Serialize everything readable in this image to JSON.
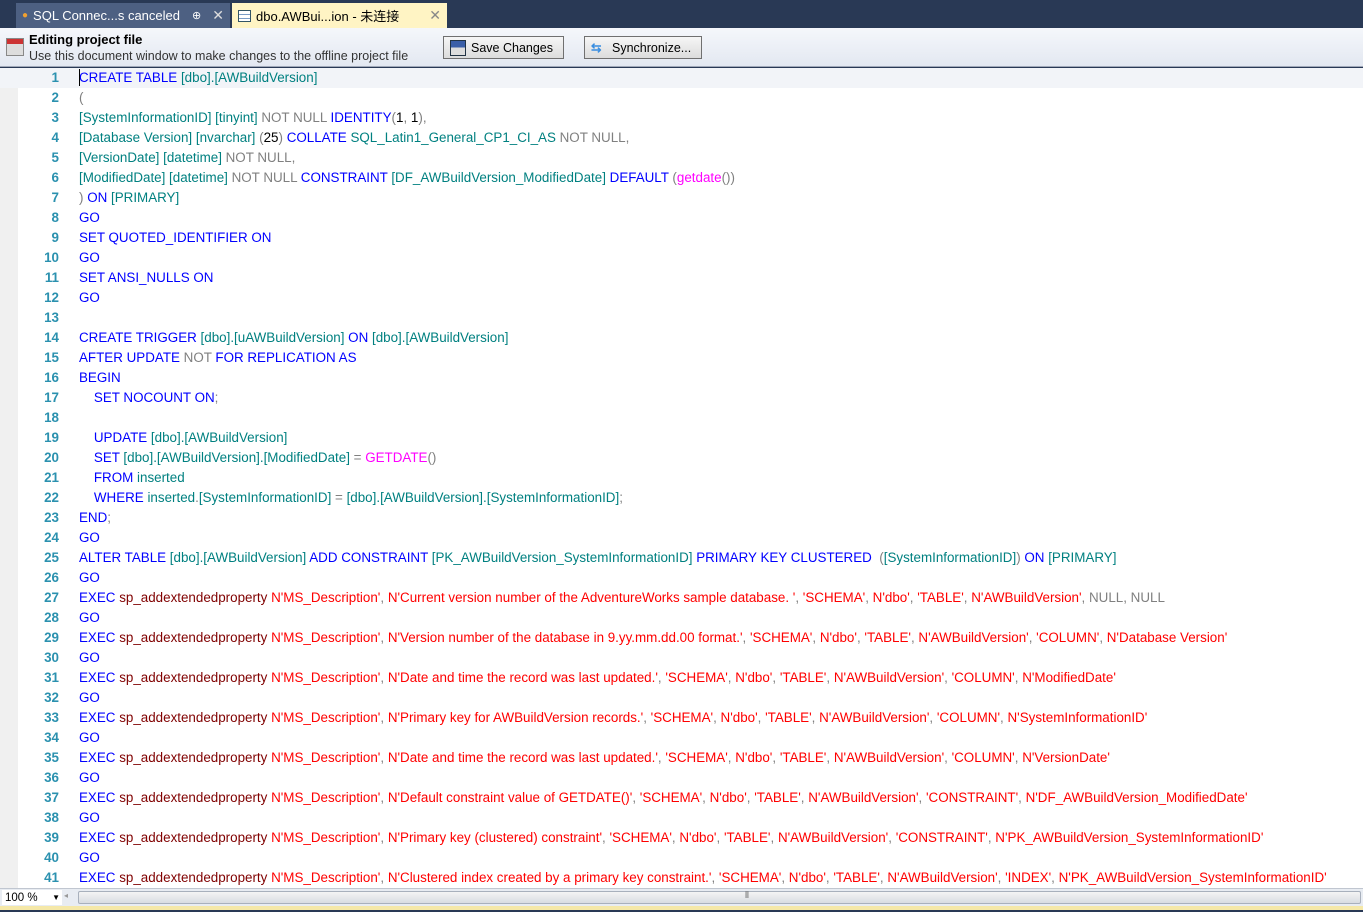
{
  "tabs": [
    {
      "label": "SQL Connec...s canceled",
      "icon": "connection-icon",
      "pin": "⊕",
      "close": "✕"
    },
    {
      "label": "dbo.AWBui...ion - 未连接",
      "icon": "table-icon",
      "close": "✕"
    }
  ],
  "infobar": {
    "title": "Editing project file",
    "subtitle": "Use this document window to make changes to the offline project file",
    "save_label": "Save Changes",
    "sync_label": "Synchronize..."
  },
  "colors": {
    "keyword": "#0000ff",
    "identifier": "#008080",
    "operator": "#808080",
    "string": "#ff0000",
    "function": "#ff00ff",
    "sysproc": "#800000",
    "line_number": "#2b91af"
  },
  "editor": {
    "zoom": "100 %",
    "lines": [
      [
        [
          "k",
          "CREATE TABLE "
        ],
        [
          "i",
          "[dbo].[AWBuildVersion]"
        ]
      ],
      [
        [
          "g",
          "("
        ]
      ],
      [
        [
          "i",
          "[SystemInformationID] [tinyint] "
        ],
        [
          "g",
          "NOT NULL "
        ],
        [
          "k",
          "IDENTITY"
        ],
        [
          "g",
          "("
        ],
        [
          "n",
          "1"
        ],
        [
          "g",
          ", "
        ],
        [
          "n",
          "1"
        ],
        [
          "g",
          "),"
        ]
      ],
      [
        [
          "i",
          "[Database Version] [nvarchar] "
        ],
        [
          "g",
          "("
        ],
        [
          "n",
          "25"
        ],
        [
          "g",
          ") "
        ],
        [
          "k",
          "COLLATE "
        ],
        [
          "i",
          "SQL_Latin1_General_CP1_CI_AS "
        ],
        [
          "g",
          "NOT NULL,"
        ]
      ],
      [
        [
          "i",
          "[VersionDate] [datetime] "
        ],
        [
          "g",
          "NOT NULL,"
        ]
      ],
      [
        [
          "i",
          "[ModifiedDate] [datetime] "
        ],
        [
          "g",
          "NOT NULL "
        ],
        [
          "k",
          "CONSTRAINT "
        ],
        [
          "i",
          "[DF_AWBuildVersion_ModifiedDate] "
        ],
        [
          "k",
          "DEFAULT "
        ],
        [
          "g",
          "("
        ],
        [
          "f",
          "getdate"
        ],
        [
          "g",
          "())"
        ]
      ],
      [
        [
          "g",
          ") "
        ],
        [
          "k",
          "ON "
        ],
        [
          "i",
          "[PRIMARY]"
        ]
      ],
      [
        [
          "k",
          "GO"
        ]
      ],
      [
        [
          "k",
          "SET QUOTED_IDENTIFIER ON"
        ]
      ],
      [
        [
          "k",
          "GO"
        ]
      ],
      [
        [
          "k",
          "SET ANSI_NULLS ON"
        ]
      ],
      [
        [
          "k",
          "GO"
        ]
      ],
      [],
      [
        [
          "k",
          "CREATE TRIGGER "
        ],
        [
          "i",
          "[dbo].[uAWBuildVersion] "
        ],
        [
          "k",
          "ON "
        ],
        [
          "i",
          "[dbo].[AWBuildVersion]"
        ]
      ],
      [
        [
          "k",
          "AFTER UPDATE "
        ],
        [
          "g",
          "NOT "
        ],
        [
          "k",
          "FOR REPLICATION AS"
        ]
      ],
      [
        [
          "k",
          "BEGIN"
        ]
      ],
      [
        [
          "k",
          "    SET NOCOUNT ON"
        ],
        [
          "g",
          ";"
        ]
      ],
      [],
      [
        [
          "k",
          "    UPDATE "
        ],
        [
          "i",
          "[dbo].[AWBuildVersion]"
        ]
      ],
      [
        [
          "k",
          "    SET "
        ],
        [
          "i",
          "[dbo].[AWBuildVersion].[ModifiedDate] "
        ],
        [
          "g",
          "= "
        ],
        [
          "f",
          "GETDATE"
        ],
        [
          "g",
          "()"
        ]
      ],
      [
        [
          "k",
          "    FROM "
        ],
        [
          "i",
          "inserted"
        ]
      ],
      [
        [
          "k",
          "    WHERE "
        ],
        [
          "i",
          "inserted"
        ],
        [
          "g",
          "."
        ],
        [
          "i",
          "[SystemInformationID] "
        ],
        [
          "g",
          "= "
        ],
        [
          "i",
          "[dbo].[AWBuildVersion].[SystemInformationID]"
        ],
        [
          "g",
          ";"
        ]
      ],
      [
        [
          "k",
          "END"
        ],
        [
          "g",
          ";"
        ]
      ],
      [
        [
          "k",
          "GO"
        ]
      ],
      [
        [
          "k",
          "ALTER TABLE "
        ],
        [
          "i",
          "[dbo].[AWBuildVersion] "
        ],
        [
          "k",
          "ADD CONSTRAINT "
        ],
        [
          "i",
          "[PK_AWBuildVersion_SystemInformationID] "
        ],
        [
          "k",
          "PRIMARY KEY CLUSTERED "
        ],
        [
          "g",
          " ("
        ],
        [
          "i",
          "[SystemInformationID]"
        ],
        [
          "g",
          ") "
        ],
        [
          "k",
          "ON "
        ],
        [
          "i",
          "[PRIMARY]"
        ]
      ],
      [
        [
          "k",
          "GO"
        ]
      ],
      [
        [
          "k",
          "EXEC "
        ],
        [
          "p",
          "sp_addextendedproperty "
        ],
        [
          "s",
          "N'MS_Description'"
        ],
        [
          "g",
          ", "
        ],
        [
          "s",
          "N'Current version number of the AdventureWorks sample database. '"
        ],
        [
          "g",
          ", "
        ],
        [
          "s",
          "'SCHEMA'"
        ],
        [
          "g",
          ", "
        ],
        [
          "s",
          "N'dbo'"
        ],
        [
          "g",
          ", "
        ],
        [
          "s",
          "'TABLE'"
        ],
        [
          "g",
          ", "
        ],
        [
          "s",
          "N'AWBuildVersion'"
        ],
        [
          "g",
          ", NULL, NULL"
        ]
      ],
      [
        [
          "k",
          "GO"
        ]
      ],
      [
        [
          "k",
          "EXEC "
        ],
        [
          "p",
          "sp_addextendedproperty "
        ],
        [
          "s",
          "N'MS_Description'"
        ],
        [
          "g",
          ", "
        ],
        [
          "s",
          "N'Version number of the database in 9.yy.mm.dd.00 format.'"
        ],
        [
          "g",
          ", "
        ],
        [
          "s",
          "'SCHEMA'"
        ],
        [
          "g",
          ", "
        ],
        [
          "s",
          "N'dbo'"
        ],
        [
          "g",
          ", "
        ],
        [
          "s",
          "'TABLE'"
        ],
        [
          "g",
          ", "
        ],
        [
          "s",
          "N'AWBuildVersion'"
        ],
        [
          "g",
          ", "
        ],
        [
          "s",
          "'COLUMN'"
        ],
        [
          "g",
          ", "
        ],
        [
          "s",
          "N'Database Version'"
        ]
      ],
      [
        [
          "k",
          "GO"
        ]
      ],
      [
        [
          "k",
          "EXEC "
        ],
        [
          "p",
          "sp_addextendedproperty "
        ],
        [
          "s",
          "N'MS_Description'"
        ],
        [
          "g",
          ", "
        ],
        [
          "s",
          "N'Date and time the record was last updated.'"
        ],
        [
          "g",
          ", "
        ],
        [
          "s",
          "'SCHEMA'"
        ],
        [
          "g",
          ", "
        ],
        [
          "s",
          "N'dbo'"
        ],
        [
          "g",
          ", "
        ],
        [
          "s",
          "'TABLE'"
        ],
        [
          "g",
          ", "
        ],
        [
          "s",
          "N'AWBuildVersion'"
        ],
        [
          "g",
          ", "
        ],
        [
          "s",
          "'COLUMN'"
        ],
        [
          "g",
          ", "
        ],
        [
          "s",
          "N'ModifiedDate'"
        ]
      ],
      [
        [
          "k",
          "GO"
        ]
      ],
      [
        [
          "k",
          "EXEC "
        ],
        [
          "p",
          "sp_addextendedproperty "
        ],
        [
          "s",
          "N'MS_Description'"
        ],
        [
          "g",
          ", "
        ],
        [
          "s",
          "N'Primary key for AWBuildVersion records.'"
        ],
        [
          "g",
          ", "
        ],
        [
          "s",
          "'SCHEMA'"
        ],
        [
          "g",
          ", "
        ],
        [
          "s",
          "N'dbo'"
        ],
        [
          "g",
          ", "
        ],
        [
          "s",
          "'TABLE'"
        ],
        [
          "g",
          ", "
        ],
        [
          "s",
          "N'AWBuildVersion'"
        ],
        [
          "g",
          ", "
        ],
        [
          "s",
          "'COLUMN'"
        ],
        [
          "g",
          ", "
        ],
        [
          "s",
          "N'SystemInformationID'"
        ]
      ],
      [
        [
          "k",
          "GO"
        ]
      ],
      [
        [
          "k",
          "EXEC "
        ],
        [
          "p",
          "sp_addextendedproperty "
        ],
        [
          "s",
          "N'MS_Description'"
        ],
        [
          "g",
          ", "
        ],
        [
          "s",
          "N'Date and time the record was last updated.'"
        ],
        [
          "g",
          ", "
        ],
        [
          "s",
          "'SCHEMA'"
        ],
        [
          "g",
          ", "
        ],
        [
          "s",
          "N'dbo'"
        ],
        [
          "g",
          ", "
        ],
        [
          "s",
          "'TABLE'"
        ],
        [
          "g",
          ", "
        ],
        [
          "s",
          "N'AWBuildVersion'"
        ],
        [
          "g",
          ", "
        ],
        [
          "s",
          "'COLUMN'"
        ],
        [
          "g",
          ", "
        ],
        [
          "s",
          "N'VersionDate'"
        ]
      ],
      [
        [
          "k",
          "GO"
        ]
      ],
      [
        [
          "k",
          "EXEC "
        ],
        [
          "p",
          "sp_addextendedproperty "
        ],
        [
          "s",
          "N'MS_Description'"
        ],
        [
          "g",
          ", "
        ],
        [
          "s",
          "N'Default constraint value of GETDATE()'"
        ],
        [
          "g",
          ", "
        ],
        [
          "s",
          "'SCHEMA'"
        ],
        [
          "g",
          ", "
        ],
        [
          "s",
          "N'dbo'"
        ],
        [
          "g",
          ", "
        ],
        [
          "s",
          "'TABLE'"
        ],
        [
          "g",
          ", "
        ],
        [
          "s",
          "N'AWBuildVersion'"
        ],
        [
          "g",
          ", "
        ],
        [
          "s",
          "'CONSTRAINT'"
        ],
        [
          "g",
          ", "
        ],
        [
          "s",
          "N'DF_AWBuildVersion_ModifiedDate'"
        ]
      ],
      [
        [
          "k",
          "GO"
        ]
      ],
      [
        [
          "k",
          "EXEC "
        ],
        [
          "p",
          "sp_addextendedproperty "
        ],
        [
          "s",
          "N'MS_Description'"
        ],
        [
          "g",
          ", "
        ],
        [
          "s",
          "N'Primary key (clustered) constraint'"
        ],
        [
          "g",
          ", "
        ],
        [
          "s",
          "'SCHEMA'"
        ],
        [
          "g",
          ", "
        ],
        [
          "s",
          "N'dbo'"
        ],
        [
          "g",
          ", "
        ],
        [
          "s",
          "'TABLE'"
        ],
        [
          "g",
          ", "
        ],
        [
          "s",
          "N'AWBuildVersion'"
        ],
        [
          "g",
          ", "
        ],
        [
          "s",
          "'CONSTRAINT'"
        ],
        [
          "g",
          ", "
        ],
        [
          "s",
          "N'PK_AWBuildVersion_SystemInformationID'"
        ]
      ],
      [
        [
          "k",
          "GO"
        ]
      ],
      [
        [
          "k",
          "EXEC "
        ],
        [
          "p",
          "sp_addextendedproperty "
        ],
        [
          "s",
          "N'MS_Description'"
        ],
        [
          "g",
          ", "
        ],
        [
          "s",
          "N'Clustered index created by a primary key constraint.'"
        ],
        [
          "g",
          ", "
        ],
        [
          "s",
          "'SCHEMA'"
        ],
        [
          "g",
          ", "
        ],
        [
          "s",
          "N'dbo'"
        ],
        [
          "g",
          ", "
        ],
        [
          "s",
          "'TABLE'"
        ],
        [
          "g",
          ", "
        ],
        [
          "s",
          "N'AWBuildVersion'"
        ],
        [
          "g",
          ", "
        ],
        [
          "s",
          "'INDEX'"
        ],
        [
          "g",
          ", "
        ],
        [
          "s",
          "N'PK_AWBuildVersion_SystemInformationID'"
        ]
      ]
    ]
  }
}
